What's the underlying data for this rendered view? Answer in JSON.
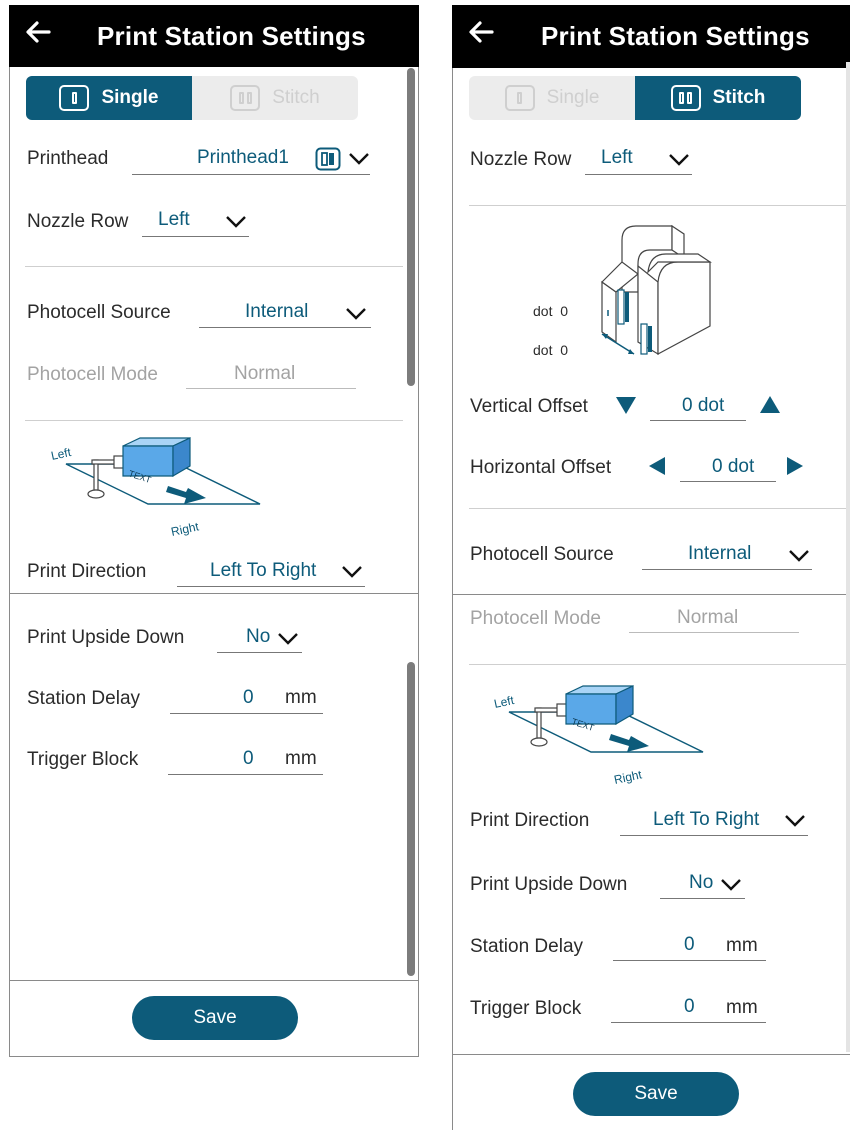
{
  "header": {
    "title": "Print Station Settings"
  },
  "mode_toggle": {
    "single_label": "Single",
    "stitch_label": "Stitch"
  },
  "fields": {
    "printhead_label": "Printhead",
    "printhead_value": "Printhead1",
    "nozzle_row_label": "Nozzle Row",
    "nozzle_row_value": "Left",
    "photocell_source_label": "Photocell Source",
    "photocell_source_value": "Internal",
    "photocell_mode_label": "Photocell Mode",
    "photocell_mode_value": "Normal",
    "print_direction_label": "Print Direction",
    "print_direction_value": "Left To Right",
    "print_upside_down_label": "Print Upside Down",
    "print_upside_down_value": "No",
    "station_delay_label": "Station Delay",
    "station_delay_value": "0",
    "trigger_block_label": "Trigger Block",
    "trigger_block_value": "0",
    "unit_mm": "mm"
  },
  "stitch": {
    "dot_label_top": "dot  0",
    "dot_label_bottom": "dot  0",
    "vertical_offset_label": "Vertical Offset",
    "vertical_offset_value": "0 dot",
    "horizontal_offset_label": "Horizontal Offset",
    "horizontal_offset_value": "0 dot"
  },
  "diagram": {
    "left_label": "Left",
    "right_label": "Right",
    "text_label": "TEXT"
  },
  "save_label": "Save",
  "colors": {
    "accent": "#0d5b7a",
    "header_bg": "#000000",
    "box_fill": "#5aa8e8"
  }
}
